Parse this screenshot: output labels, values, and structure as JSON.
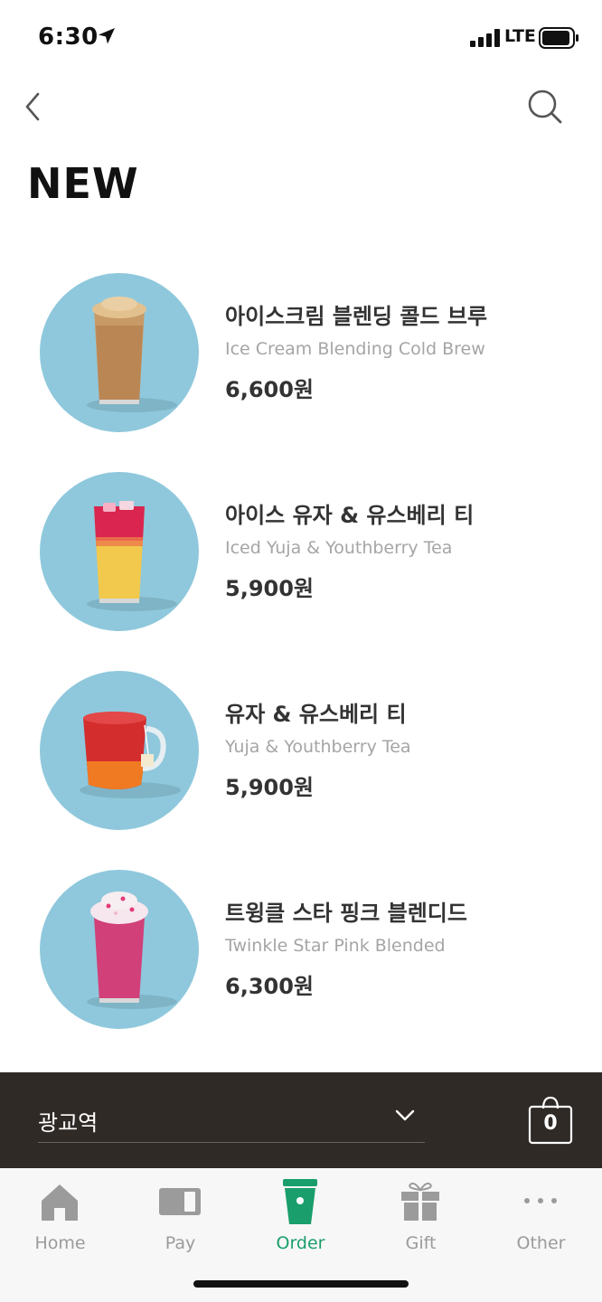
{
  "status": {
    "time": "6:30",
    "network": "LTE",
    "icons": [
      "location-arrow-icon",
      "signal-icon",
      "battery-icon"
    ]
  },
  "header": {
    "title": "NEW",
    "icons": [
      "back-chevron-icon",
      "search-icon"
    ]
  },
  "products": [
    {
      "name_ko": "아이스크림 블렌딩 콜드 브루",
      "name_en": "Ice Cream Blending Cold Brew",
      "price": "6,600원"
    },
    {
      "name_ko": "아이스 유자 & 유스베리 티",
      "name_en": "Iced Yuja & Youthberry Tea",
      "price": "5,900원"
    },
    {
      "name_ko": "유자 & 유스베리 티",
      "name_en": "Yuja & Youthberry Tea",
      "price": "5,900원"
    },
    {
      "name_ko": "트윙클 스타 핑크 블렌디드",
      "name_en": "Twinkle Star Pink Blended",
      "price": "6,300원"
    }
  ],
  "store": {
    "name": "광교역",
    "cart_count": "0"
  },
  "tabs": [
    {
      "label": "Home",
      "icon": "home-icon"
    },
    {
      "label": "Pay",
      "icon": "card-icon"
    },
    {
      "label": "Order",
      "icon": "cup-icon",
      "active": true
    },
    {
      "label": "Gift",
      "icon": "gift-icon"
    },
    {
      "label": "Other",
      "icon": "more-dots-icon"
    }
  ],
  "colors": {
    "accent": "#1a9e6b",
    "thumb_bg": "#8fc8dc",
    "store_bar": "#2f2a26",
    "tab_inactive": "#9b9b9b"
  }
}
